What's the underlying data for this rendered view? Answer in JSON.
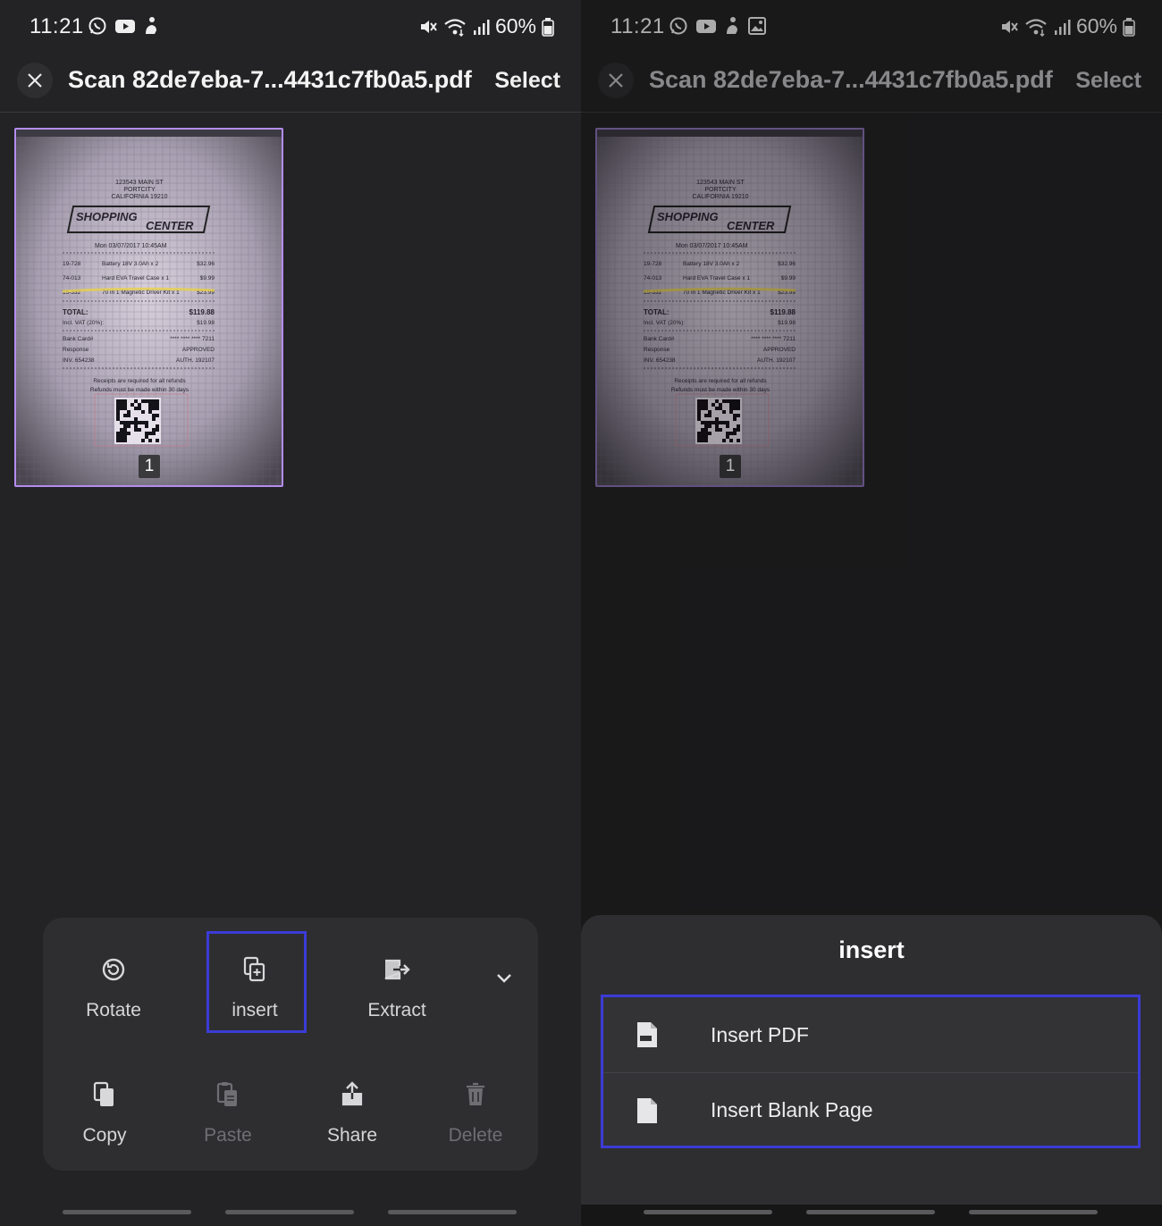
{
  "screens": [
    {
      "status": {
        "time": "11:21",
        "battery": "60%"
      },
      "header": {
        "title": "Scan 82de7eba-7...4431c7fb0a5.pdf",
        "select_label": "Select"
      },
      "page_badge": "1",
      "actions": {
        "rotate": "Rotate",
        "insert": "insert",
        "extract": "Extract",
        "copy": "Copy",
        "paste": "Paste",
        "share": "Share",
        "delete": "Delete"
      }
    },
    {
      "status": {
        "time": "11:21",
        "battery": "60%"
      },
      "header": {
        "title": "Scan 82de7eba-7...4431c7fb0a5.pdf",
        "select_label": "Select"
      },
      "page_badge": "1",
      "insert_sheet": {
        "title": "insert",
        "options": [
          "Insert PDF",
          "Insert Blank Page"
        ]
      }
    }
  ],
  "receipt": {
    "address": [
      "123543 MAIN ST",
      "PORTCITY",
      "CALIFORNIA 19210"
    ],
    "store": [
      "SHOPPING",
      "CENTER"
    ],
    "date_line": "Mon   03/07/2017   10:45AM",
    "items": [
      [
        "19-728",
        "Battery 18V 3.0Ah x 2",
        "$32.96"
      ],
      [
        "74-013",
        "Hard EVA Travel Case x 1",
        "$9.99"
      ],
      [
        "15-332",
        "70 in 1 Magnetic Driver Kit x 1",
        "$23.99"
      ]
    ],
    "total_label": "TOTAL:",
    "total_value": "$119.88",
    "vat_label": "Incl. VAT (20%):",
    "vat_value": "$19.98",
    "card_label": "Bank Card#",
    "card_value": "**** **** **** 7211",
    "response_label": "Response",
    "response_value": "APPROVED",
    "inv_label": "INV.   654238",
    "auth_label": "AUTH.   192107",
    "footer": [
      "Receipts are required for all refunds",
      "Refunds must be made within 30 days"
    ]
  },
  "colors": {
    "highlight": "#3b3bd6",
    "thumb_border": "#b48cf0",
    "panel_bg": "#232325",
    "sheet_bg": "#2e2e31"
  },
  "icons": {
    "close": "close-icon",
    "rotate": "rotate-icon",
    "insert": "insert-page-icon",
    "extract": "extract-icon",
    "copy": "copy-icon",
    "paste": "paste-icon",
    "share": "share-icon",
    "delete": "trash-icon",
    "expand": "chevron-down-icon",
    "insert_pdf": "pdf-file-icon",
    "insert_blank": "blank-file-icon"
  }
}
